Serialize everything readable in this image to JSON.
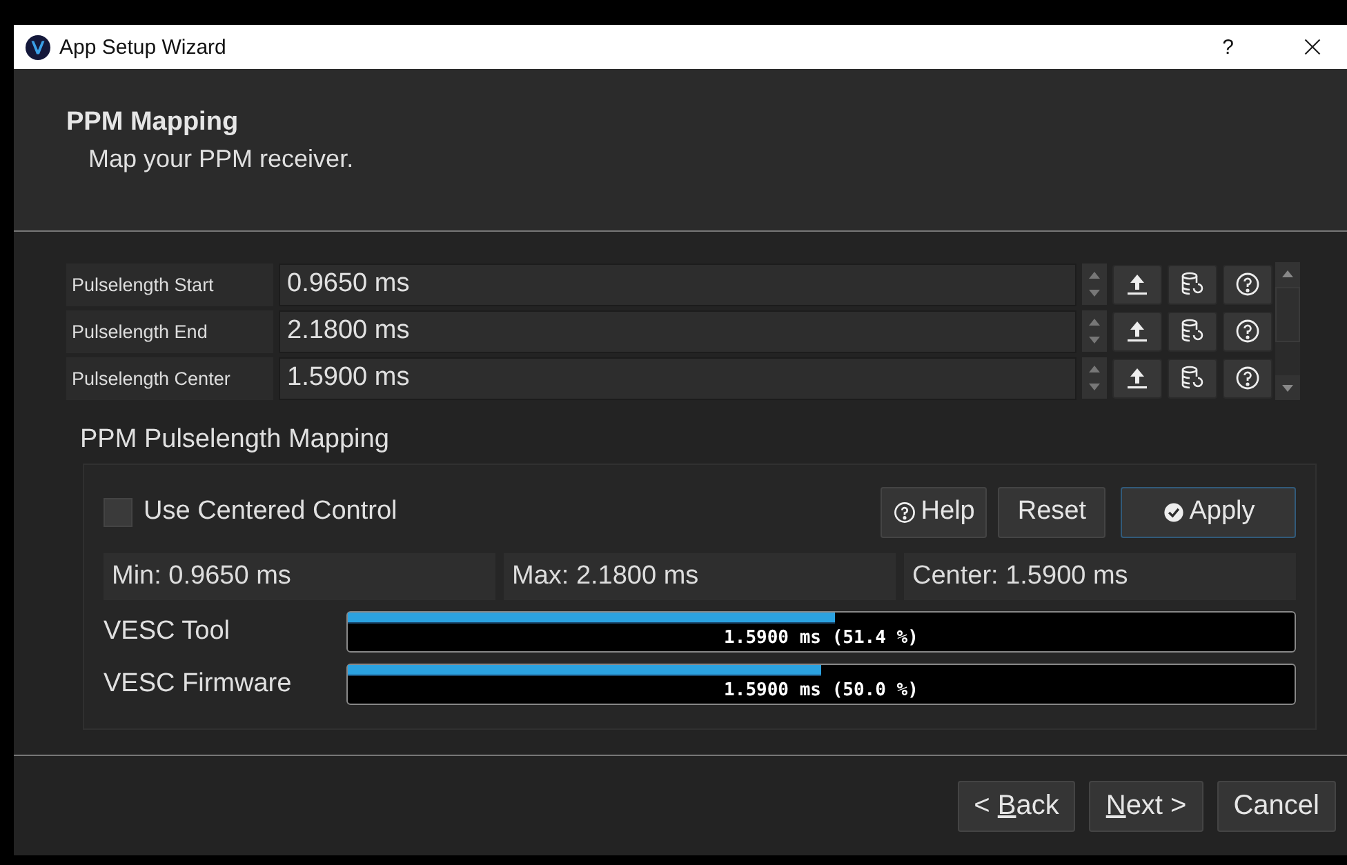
{
  "window": {
    "title": "App Setup Wizard",
    "help_button": "?"
  },
  "header": {
    "title": "PPM Mapping",
    "subtitle": "Map your PPM receiver."
  },
  "parameters": [
    {
      "label": "Pulselength Start",
      "value": "0.9650 ms"
    },
    {
      "label": "Pulselength End",
      "value": "2.1800 ms"
    },
    {
      "label": "Pulselength Center",
      "value": "1.5900 ms"
    }
  ],
  "mapping": {
    "title": "PPM Pulselength Mapping",
    "centered_control": {
      "label": "Use Centered Control",
      "checked": false
    },
    "buttons": [
      {
        "label": "Help",
        "kind": "help"
      },
      {
        "label": "Reset",
        "kind": "plain"
      },
      {
        "label": "Apply",
        "kind": "apply"
      }
    ],
    "readouts": [
      "Min: 0.9650 ms",
      "Max: 2.1800 ms",
      "Center: 1.5900 ms"
    ],
    "meters": [
      {
        "name": "VESC Tool",
        "level": 0.514,
        "reading": "1.5900 ms (51.4 %)"
      },
      {
        "name": "VESC Firmware",
        "level": 0.5,
        "reading": "1.5900 ms (50.0 %)"
      }
    ]
  },
  "footer": {
    "buttons": [
      {
        "lead": "< ",
        "shortcut": "B",
        "rest": "ack"
      },
      {
        "shortcut": "N",
        "rest": "ext >"
      },
      {
        "lead": "Cancel"
      }
    ]
  }
}
